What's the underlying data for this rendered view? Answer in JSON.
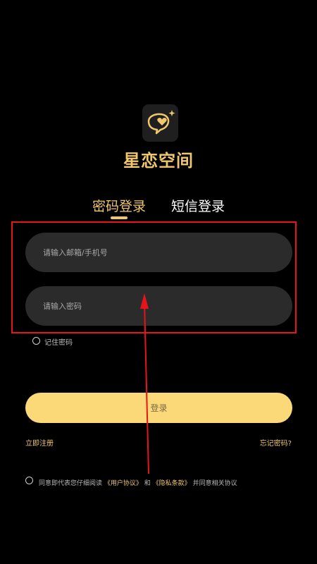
{
  "app": {
    "name": "星恋空间"
  },
  "tabs": [
    {
      "label": "密码登录",
      "active": true
    },
    {
      "label": "短信登录",
      "active": false
    }
  ],
  "form": {
    "account_placeholder": "请输入邮箱/手机号",
    "password_placeholder": "请输入密码",
    "remember_label": "记住密码",
    "login_label": "登录"
  },
  "links": {
    "register": "立即注册",
    "forgot": "忘记密码?"
  },
  "agreement": {
    "prefix": "同意即代表您仔细阅读",
    "user_agreement": "《用户协议》",
    "and": "和",
    "privacy_policy": "《隐私条款》",
    "suffix": "并同意相关协议"
  },
  "colors": {
    "accent": "#f0c66e",
    "button": "#fbd978",
    "field": "#2b2b2b",
    "annotation": "#e8141b",
    "background": "#000000"
  },
  "icons": {
    "logo": "heart-speech-bubble-icon"
  }
}
